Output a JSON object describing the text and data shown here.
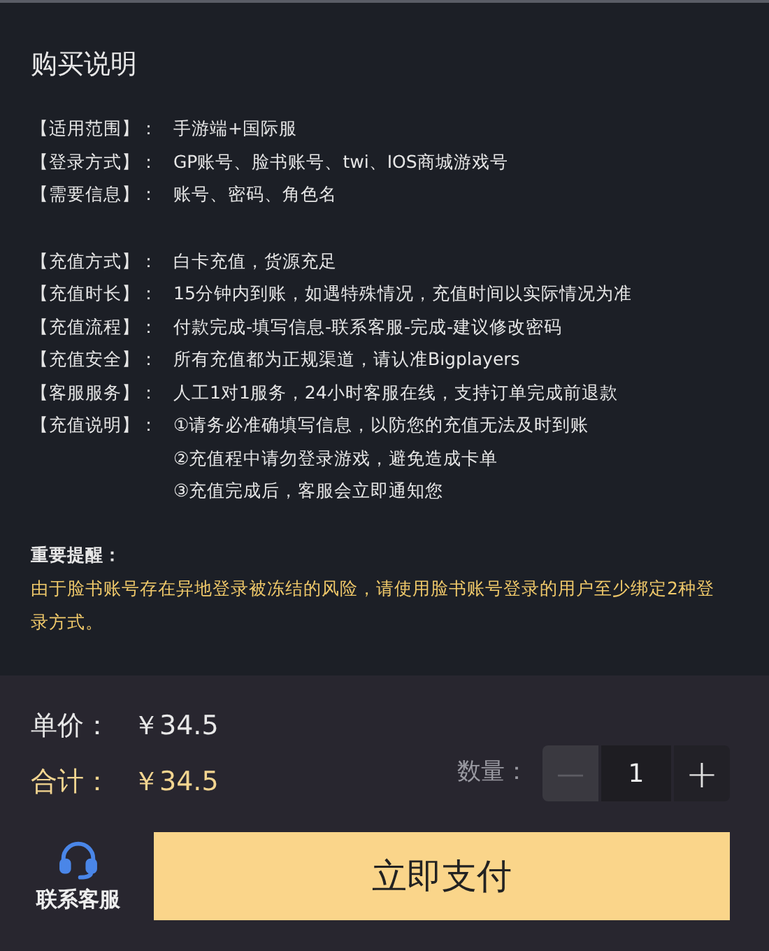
{
  "section": {
    "title": "购买说明",
    "groups": [
      {
        "rows": [
          {
            "label": "【适用范围】：",
            "lines": [
              "手游端+国际服"
            ]
          },
          {
            "label": "【登录方式】：",
            "lines": [
              "GP账号、脸书账号、twi、IOS商城游戏号"
            ]
          },
          {
            "label": "【需要信息】：",
            "lines": [
              "账号、密码、角色名"
            ]
          }
        ]
      },
      {
        "rows": [
          {
            "label": "【充值方式】：",
            "lines": [
              "白卡充值，货源充足"
            ]
          },
          {
            "label": "【充值时长】：",
            "lines": [
              "15分钟内到账，如遇特殊情况，充值时间以实际情况为准"
            ]
          },
          {
            "label": "【充值流程】：",
            "lines": [
              "付款完成-填写信息-联系客服-完成-建议修改密码"
            ]
          },
          {
            "label": "【充值安全】：",
            "lines": [
              "所有充值都为正规渠道，请认准Bigplayers"
            ]
          },
          {
            "label": "【客服服务】：",
            "lines": [
              "人工1对1服务，24小时客服在线，支持订单完成前退款"
            ]
          },
          {
            "label": "【充值说明】：",
            "lines": [
              "①请务必准确填写信息，以防您的充值无法及时到账",
              "②充值程中请勿登录游戏，避免造成卡单",
              "③充值完成后，客服会立即通知您"
            ]
          }
        ]
      }
    ],
    "notice": {
      "heading": "重要提醒：",
      "text": "由于脸书账号存在异地登录被冻结的风险，请使用脸书账号登录的用户至少绑定2种登录方式。"
    }
  },
  "order": {
    "unit_price": {
      "label": "单价：",
      "value": "￥34.5"
    },
    "total": {
      "label": "合计：",
      "value": "￥34.5"
    },
    "quantity": {
      "label": "数量：",
      "minus": "—",
      "value": "1",
      "plus": "+",
      "minus_disabled": true
    }
  },
  "footer": {
    "contact": "联系客服",
    "pay_button": "立即支付"
  }
}
